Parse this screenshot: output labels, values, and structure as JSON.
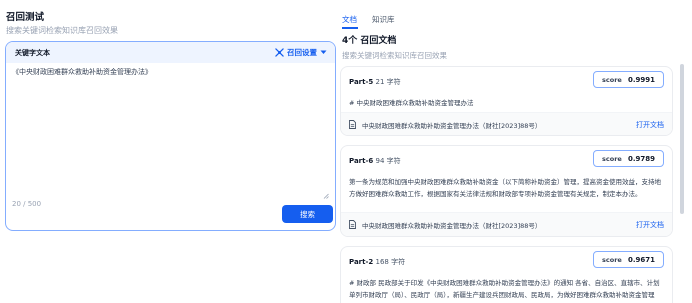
{
  "left": {
    "title": "召回测试",
    "subtitle": "搜索关键词检索知识库召回效果",
    "query_header": "关键字文本",
    "settings_label": "召回设置",
    "query_text": "《中央财政困难群众救助补助资金管理办法》",
    "char_count": "20 / 500",
    "search_label": "搜索"
  },
  "right": {
    "tabs": [
      "文档",
      "知识库"
    ],
    "active_tab": "文档",
    "results_title": "4个 召回文档",
    "results_subtitle": "搜索关键词检索知识库召回效果",
    "score_label": "score",
    "open_doc_label": "打开文档",
    "results": [
      {
        "part": "Part-5",
        "chars": "21 字符",
        "score": "0.9991",
        "content": "# 中央财政困难群众救助补助资金管理办法",
        "source": "中央财政困难群众救助补助资金管理办法（财社[2023]88号）"
      },
      {
        "part": "Part-6",
        "chars": "94 字符",
        "score": "0.9789",
        "content": "第一条为规范和加强中央财政困难群众救助补助资金（以下简称补助资金）管理，提高资金使用效益，支持地方做好困难群众救助工作，根据国家有关法律法规和财政部专项补助资金管理有关规定，制定本办法。",
        "source": "中央财政困难群众救助补助资金管理办法（财社[2023]88号）"
      },
      {
        "part": "Part-2",
        "chars": "168 字符",
        "score": "0.9671",
        "content": "# 财政部 民政部关于印发《中央财政困难群众救助补助资金管理办法》的通知 各省、自治区、直辖市、计划单列市财政厅（局）、民政厅（局），新疆生产建设兵团财政局、民政局，为做好困难群众救助补助资金管理",
        "source": ""
      }
    ]
  },
  "colors": {
    "accent": "#155eef",
    "accent_light": "#84adff",
    "header_bg": "#eef4ff"
  }
}
